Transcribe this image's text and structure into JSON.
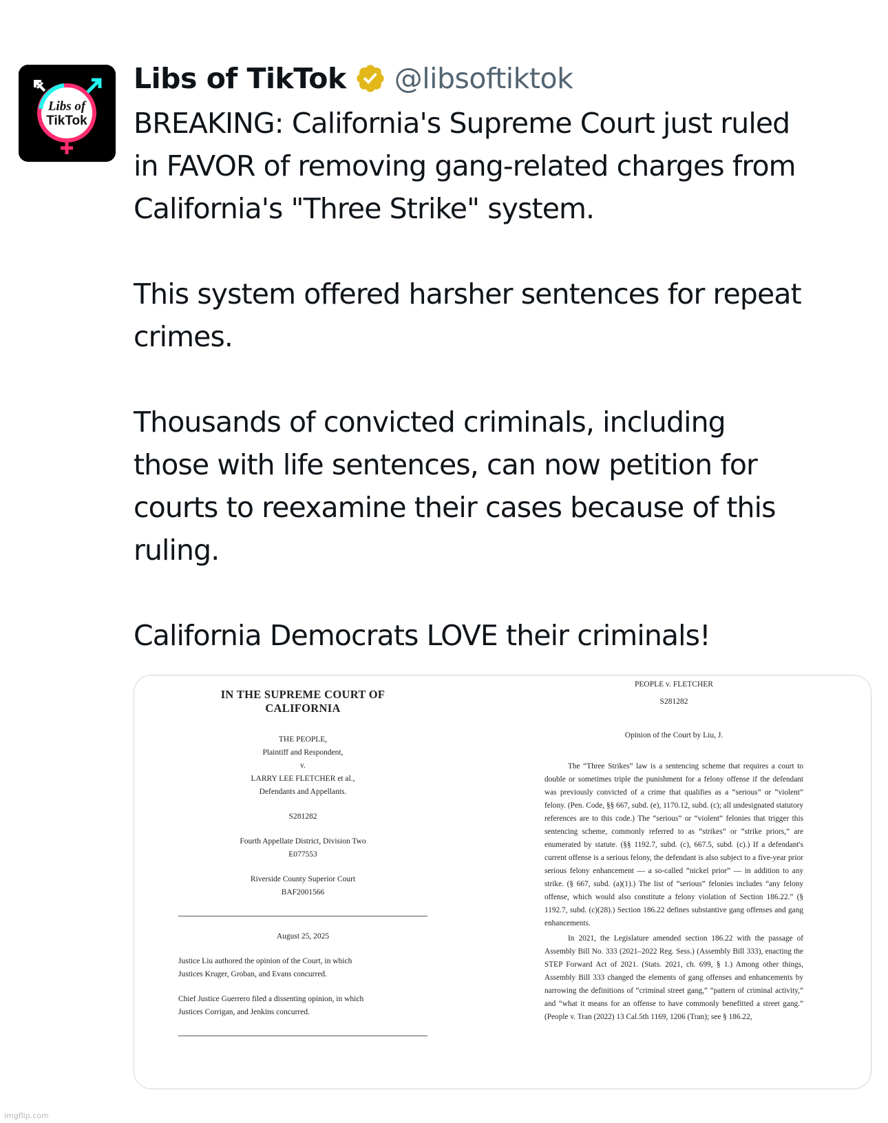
{
  "account": {
    "display_name": "Libs of TikTok",
    "handle": "@libsoftiktok",
    "avatar_text_line1": "Libs of",
    "avatar_text_line2": "TikTok",
    "verified": true,
    "badge_color": "#e2b719"
  },
  "tweet": {
    "paragraphs": [
      [
        "BREAKING: California's Supreme Court just ruled",
        "in FAVOR of removing gang-related charges from",
        "California's \"Three Strike\" system."
      ],
      [
        "This system offered harsher sentences for repeat",
        "crimes."
      ],
      [
        "Thousands of convicted criminals, including",
        "those with life sentences, can now petition for",
        "courts to reexamine their cases because of this",
        "ruling."
      ],
      [
        "California Democrats LOVE their criminals!"
      ]
    ]
  },
  "document": {
    "cover": {
      "court_title_line1": "IN THE SUPREME COURT OF",
      "court_title_line2": "CALIFORNIA",
      "parties": [
        "THE PEOPLE,",
        "Plaintiff and Respondent,",
        "v.",
        "LARRY LEE FLETCHER et al.,",
        "Defendants and Appellants."
      ],
      "case_number": "S281282",
      "appellate": [
        "Fourth Appellate District, Division Two",
        "E077553"
      ],
      "superior": [
        "Riverside County Superior Court",
        "BAF2001566"
      ],
      "date": "August 25, 2025",
      "authorship": [
        "Justice Liu authored the opinion of the Court, in which",
        "Justices Kruger, Groban, and Evans concurred."
      ],
      "dissent": [
        "Chief Justice Guerrero filed a dissenting opinion, in which",
        "Justices Corrigan, and Jenkins concurred."
      ]
    },
    "opinion": {
      "caption": "PEOPLE v. FLETCHER",
      "case_number": "S281282",
      "byline": "Opinion of the Court by Liu, J.",
      "para1": "The “Three Strikes” law is a sentencing scheme that requires a court to double or sometimes triple the punishment for a felony offense if the defendant was previously convicted of a crime that qualifies as a “serious” or “violent” felony. (Pen. Code, §§ 667, subd. (e), 1170.12, subd. (c); all undesignated statutory references are to this code.) The “serious” or “violent” felonies that trigger this sentencing scheme, commonly referred to as “strikes” or “strike priors,” are enumerated by statute. (§§ 1192.7, subd. (c), 667.5, subd. (c).) If a defendant's current offense is a serious felony, the defendant is also subject to a five-year prior serious felony enhancement — a so-called “nickel prior” — in addition to any strike. (§ 667, subd. (a)(1).) The list of “serious” felonies includes “any felony offense, which would also constitute a felony violation of Section 186.22.” (§ 1192.7, subd. (c)(28).) Section 186.22 defines substantive gang offenses and gang enhancements.",
      "para2": "In 2021, the Legislature amended section 186.22 with the passage of Assembly Bill No. 333 (2021–2022 Reg. Sess.) (Assembly Bill 333), enacting the STEP Forward Act of 2021. (Stats. 2021, ch. 699, § 1.) Among other things, Assembly Bill 333 changed the elements of gang offenses and enhancements by narrowing the definitions of “criminal street gang,” “pattern of criminal activity,” and “what it means for an offense to have commonly benefitted a street gang.” (People v. Tran (2022) 13 Cal.5th 1169, 1206 (Tran); see § 186.22,"
    }
  },
  "watermark": "imgflip.com"
}
